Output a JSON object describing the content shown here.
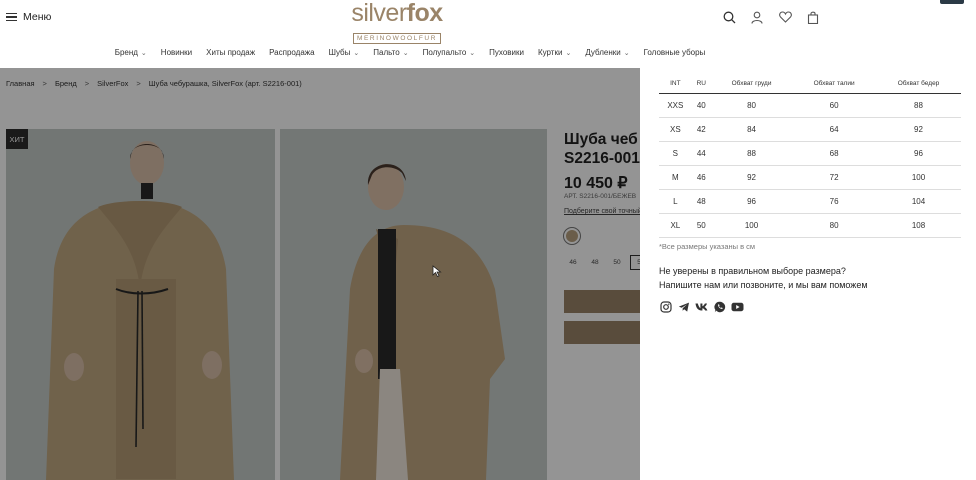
{
  "header": {
    "menu_label": "Меню",
    "logo_light": "silver",
    "logo_bold": "fox",
    "logo_sub": "MERINOWOOLFUR",
    "icons": [
      "search-icon",
      "user-icon",
      "heart-icon",
      "bag-icon"
    ]
  },
  "nav": [
    {
      "label": "Бренд",
      "dropdown": true
    },
    {
      "label": "Новинки",
      "dropdown": false
    },
    {
      "label": "Хиты продаж",
      "dropdown": false
    },
    {
      "label": "Распродажа",
      "dropdown": false
    },
    {
      "label": "Шубы",
      "dropdown": true
    },
    {
      "label": "Пальто",
      "dropdown": true
    },
    {
      "label": "Полупальто",
      "dropdown": true
    },
    {
      "label": "Пуховики",
      "dropdown": false
    },
    {
      "label": "Куртки",
      "dropdown": true
    },
    {
      "label": "Дубленки",
      "dropdown": true
    },
    {
      "label": "Головные уборы",
      "dropdown": false
    }
  ],
  "breadcrumbs": [
    "Главная",
    "Бренд",
    "SilverFox",
    "Шуба чебурашка, SilverFox (арт. S2216-001)"
  ],
  "breadcrumb_sep": ">",
  "product": {
    "badge": "ХИТ",
    "title_line1": "Шуба чеб",
    "title_line2": "S2216-001",
    "price": "10 450 ₽",
    "article": "АРТ. S2216-001/БЕЖЕВ",
    "pick_size": "Подберите свой точный",
    "color": "#b7a180",
    "sizes": [
      "46",
      "48",
      "50",
      "5"
    ],
    "selected_size": "5"
  },
  "size_table": {
    "headers": [
      "INT",
      "RU",
      "Обхват груди",
      "Обхват талии",
      "Обхват бедер"
    ],
    "rows": [
      [
        "XXS",
        "40",
        "80",
        "60",
        "88"
      ],
      [
        "XS",
        "42",
        "84",
        "64",
        "92"
      ],
      [
        "S",
        "44",
        "88",
        "68",
        "96"
      ],
      [
        "M",
        "46",
        "92",
        "72",
        "100"
      ],
      [
        "L",
        "48",
        "96",
        "76",
        "104"
      ],
      [
        "XL",
        "50",
        "100",
        "80",
        "108"
      ]
    ],
    "note": "*Все размеры указаны в см",
    "help_line1": "Не уверены в правильном выборе размера?",
    "help_line2": "Напишите нам или позвоните, и мы вам поможем"
  },
  "socials": [
    "instagram-icon",
    "telegram-icon",
    "vk-icon",
    "whatsapp-icon",
    "youtube-icon"
  ],
  "colors": {
    "brand": "#9a8468",
    "overlay": "rgba(0,0,0,0.42)"
  }
}
